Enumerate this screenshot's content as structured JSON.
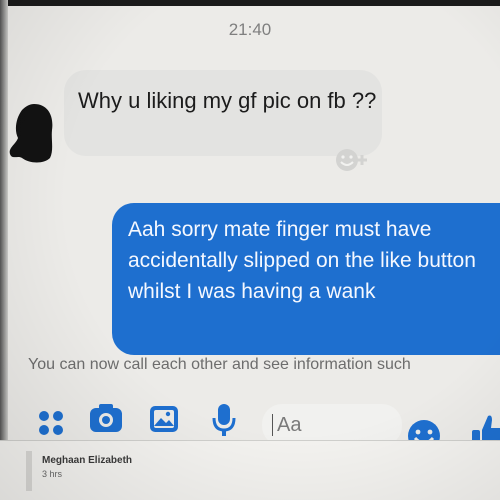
{
  "header": {
    "time": "21:40"
  },
  "messages": {
    "incoming": {
      "text": "Why u liking my gf pic on fb ??"
    },
    "outgoing": {
      "text": "Aah sorry mate finger must have accidentally slipped on the like button whilst I was having a wank"
    }
  },
  "notice": {
    "text": "You can now call each other and see information such"
  },
  "composer": {
    "placeholder": "Aa",
    "icons": [
      "more-apps-icon",
      "camera-icon",
      "gallery-icon",
      "microphone-icon",
      "emoji-icon",
      "thumbs-up-icon"
    ],
    "accent": "#1e6fcf"
  },
  "feed": {
    "name": "Meghaan Elizabeth",
    "time": "3 hrs"
  },
  "colors": {
    "outgoing_bubble": "#1e6fcf",
    "incoming_bubble": "#e3e3e1",
    "background": "#ecebe8"
  }
}
